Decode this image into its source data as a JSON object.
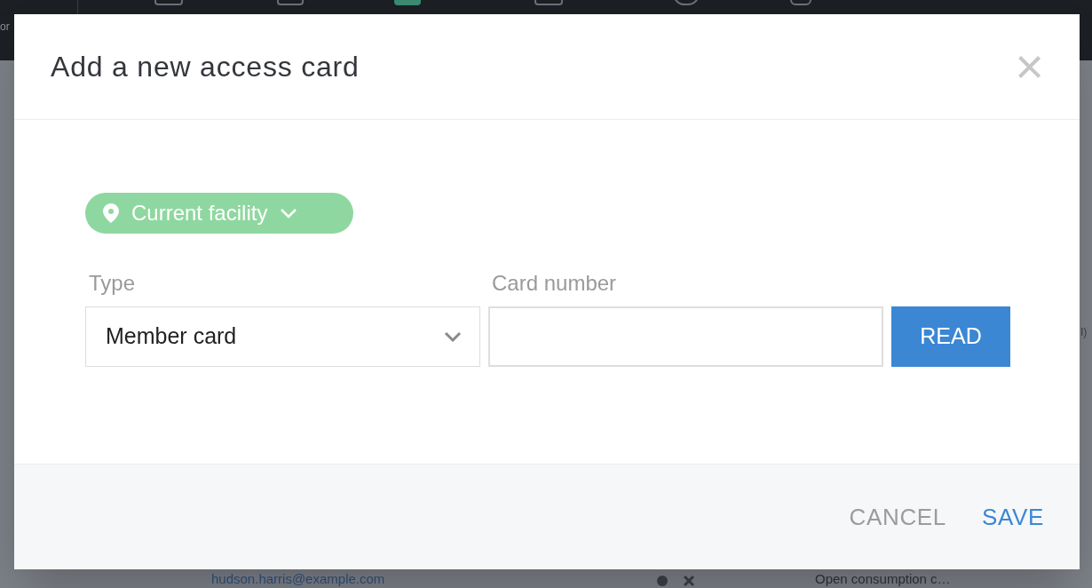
{
  "background": {
    "left_edge_text": "or",
    "right_edge_text": "I)",
    "email": "hudson.harris@example.com",
    "row_text": "Open consumption c…"
  },
  "dialog": {
    "title": "Add a new access card",
    "close": "×",
    "facility_chip": {
      "label": "Current facility"
    },
    "fields": [
      {
        "kind": "select",
        "label": "Type",
        "value": "Member card"
      },
      {
        "kind": "input",
        "label": "Card number"
      }
    ],
    "read_button": "READ",
    "footer_buttons": [
      {
        "label": "CANCEL",
        "primary": false
      },
      {
        "label": "SAVE",
        "primary": true
      }
    ]
  }
}
